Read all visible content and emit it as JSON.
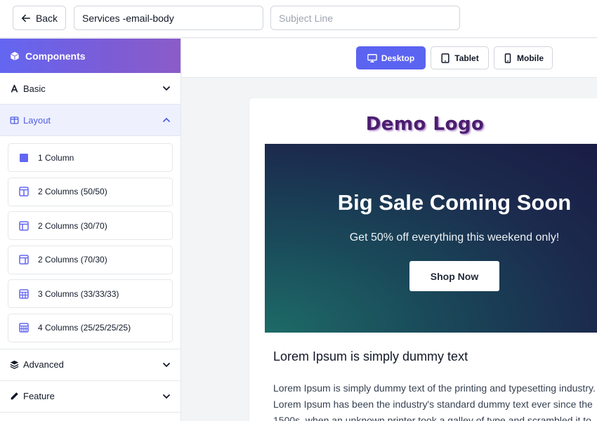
{
  "topbar": {
    "back_label": "Back",
    "template_name": "Services -email-body",
    "subject_placeholder": "Subject Line"
  },
  "sidebar": {
    "header": "Components",
    "sections": {
      "basic": "Basic",
      "layout": "Layout",
      "advanced": "Advanced",
      "feature": "Feature"
    },
    "layout_items": [
      {
        "label": "1 Column",
        "icon": "square-icon"
      },
      {
        "label": "2 Columns (50/50)",
        "icon": "columns-icon"
      },
      {
        "label": "2 Columns (30/70)",
        "icon": "columns-icon"
      },
      {
        "label": "2 Columns (70/30)",
        "icon": "columns-icon"
      },
      {
        "label": "3 Columns (33/33/33)",
        "icon": "grid-icon"
      },
      {
        "label": "4 Columns (25/25/25/25)",
        "icon": "grid-icon"
      }
    ]
  },
  "devices": {
    "desktop": "Desktop",
    "tablet": "Tablet",
    "mobile": "Mobile",
    "active": "Desktop"
  },
  "email": {
    "logo_text": "Demo Logo",
    "hero_title": "Big Sale Coming Soon",
    "hero_subtitle": "Get 50% off everything this weekend only!",
    "hero_button": "Shop Now",
    "content_title": "Lorem Ipsum is simply dummy text",
    "content_lines": [
      "Lorem Ipsum is simply dummy text of the printing and typesetting industry.",
      "Lorem Ipsum has been the industry's standard dummy text ever since the",
      "1500s, when an unknown printer took a galley of type and scrambled it to"
    ]
  },
  "colors": {
    "accent": "#5b63f1",
    "sidebar_header_start": "#6366f1",
    "sidebar_header_end": "#8b5cc8",
    "hero_dark": "#1a1c45",
    "hero_teal": "#1d6b67",
    "logo": "#4b1e6e"
  }
}
